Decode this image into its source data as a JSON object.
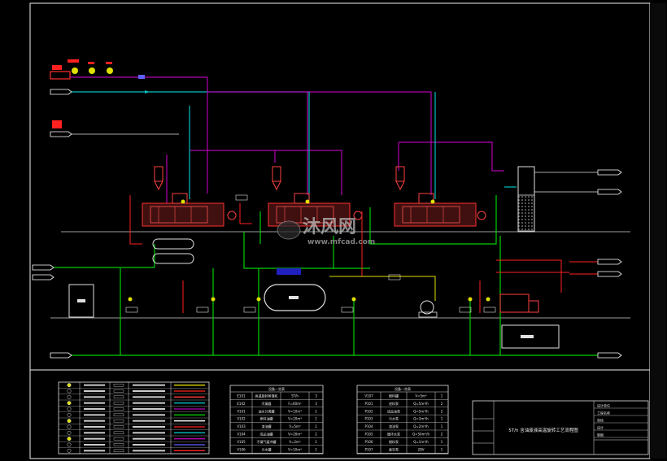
{
  "drawing": {
    "title": "5T/h 含油废液高温旋转工艺流程图",
    "title_short": "5T",
    "watermark_main": "沐风网",
    "watermark_url": "www.mfcad.com",
    "outer_line_color": "#ffffff",
    "pipe_colors": {
      "water": "#00c0c0",
      "steam": "#b000b0",
      "oil": "#00d000",
      "signal": "#e0e000",
      "gas": "#ff2020",
      "equipment": "#ff4040"
    }
  },
  "legend_table": {
    "rows": 12
  },
  "equipment_table_1": {
    "header": "设备一览表",
    "rows": [
      {
        "tag": "E101",
        "name": "高温旋转蒸馏机",
        "spec": "5T/h",
        "qty": "3"
      },
      {
        "tag": "E102",
        "name": "冷凝器",
        "spec": "F=60m²",
        "qty": "3"
      },
      {
        "tag": "V101",
        "name": "油水分离罐",
        "spec": "V=10m³",
        "qty": "1"
      },
      {
        "tag": "V102",
        "name": "原料油罐",
        "spec": "V=20m³",
        "qty": "1"
      },
      {
        "tag": "V103",
        "name": "渣油罐",
        "spec": "V=5m³",
        "qty": "1"
      },
      {
        "tag": "V104",
        "name": "成品油罐",
        "spec": "V=20m³",
        "qty": "2"
      },
      {
        "tag": "V105",
        "name": "不凝气缓冲罐",
        "spec": "V=2m³",
        "qty": "1"
      },
      {
        "tag": "V106",
        "name": "污水罐",
        "spec": "V=10m³",
        "qty": "1"
      }
    ]
  },
  "equipment_table_2": {
    "header": "设备一览表",
    "rows": [
      {
        "tag": "V107",
        "name": "燃料罐",
        "spec": "V=5m³",
        "qty": "1"
      },
      {
        "tag": "P101",
        "name": "进料泵",
        "spec": "Q=5m³/h",
        "qty": "2"
      },
      {
        "tag": "P102",
        "name": "成品油泵",
        "spec": "Q=5m³/h",
        "qty": "2"
      },
      {
        "tag": "P103",
        "name": "污水泵",
        "spec": "Q=3m³/h",
        "qty": "1"
      },
      {
        "tag": "P104",
        "name": "渣油泵",
        "spec": "Q=2m³/h",
        "qty": "1"
      },
      {
        "tag": "P105",
        "name": "循环水泵",
        "spec": "Q=50m³/h",
        "qty": "2"
      },
      {
        "tag": "P106",
        "name": "燃料泵",
        "spec": "Q=1m³/h",
        "qty": "1"
      },
      {
        "tag": "P107",
        "name": "真空泵",
        "spec": "2BV",
        "qty": "1"
      }
    ]
  },
  "title_block": {
    "rows": [
      "设计单位",
      "工程名称",
      "审核",
      "设计",
      "制图"
    ]
  },
  "stream_tags": [
    "原料油",
    "循环水",
    "燃料气",
    "去火炬",
    "不凝气",
    "去储罐",
    "成品油",
    "去污水处理",
    "渣油",
    "蒸汽"
  ]
}
